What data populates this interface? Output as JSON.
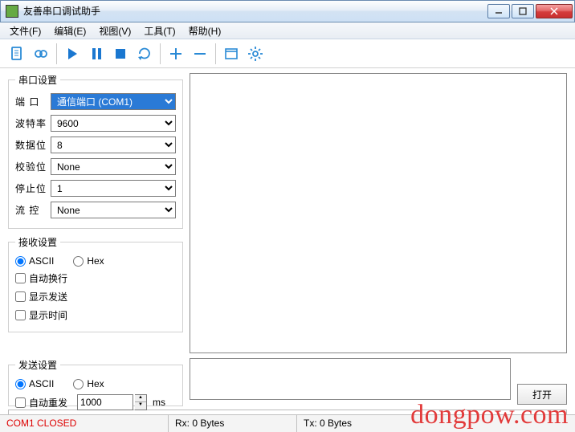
{
  "window": {
    "title": "友善串口调试助手"
  },
  "menu": {
    "file": "文件(F)",
    "edit": "编辑(E)",
    "view": "视图(V)",
    "tools": "工具(T)",
    "help": "帮助(H)"
  },
  "serial": {
    "legend": "串口设置",
    "port_label": "端  口",
    "port_value": "通信端口 (COM1)",
    "baud_label": "波特率",
    "baud_value": "9600",
    "data_label": "数据位",
    "data_value": "8",
    "parity_label": "校验位",
    "parity_value": "None",
    "stop_label": "停止位",
    "stop_value": "1",
    "flow_label": "流  控",
    "flow_value": "None"
  },
  "recv": {
    "legend": "接收设置",
    "ascii": "ASCII",
    "hex": "Hex",
    "wrap": "自动换行",
    "show_send": "显示发送",
    "show_time": "显示时间"
  },
  "send": {
    "legend": "发送设置",
    "ascii": "ASCII",
    "hex": "Hex",
    "auto_resend": "自动重发",
    "interval": "1000",
    "unit": "ms"
  },
  "buttons": {
    "open": "打开"
  },
  "status": {
    "port": "COM1 CLOSED",
    "rx": "Rx: 0 Bytes",
    "tx": "Tx: 0 Bytes"
  },
  "watermark": "dongpow.com"
}
